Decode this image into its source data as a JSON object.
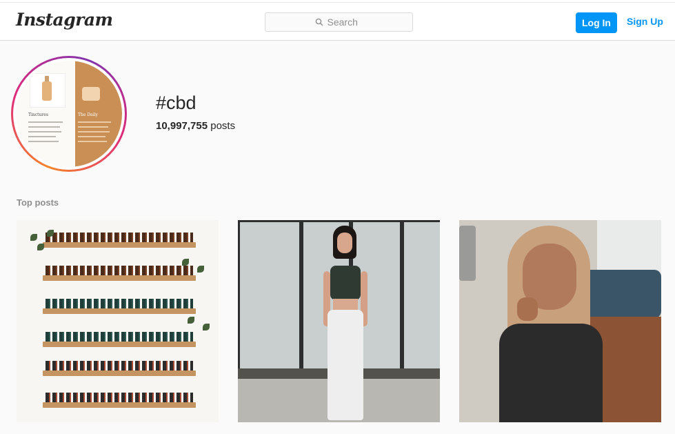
{
  "app": {
    "logo_text": "Instagram",
    "brand_color": "#0095f6"
  },
  "header": {
    "search_placeholder": "Search",
    "login_label": "Log In",
    "signup_label": "Sign Up"
  },
  "hashtag": {
    "title": "#cbd",
    "post_count": "10,997,755",
    "post_count_suffix": " posts",
    "avatar_labels": [
      "Tinctures",
      "The Daily"
    ]
  },
  "top_posts": {
    "section_title": "Top posts",
    "posts": [
      {
        "subject": "essential oil bottles on wooden shelves"
      },
      {
        "subject": "woman in white jeans standing by windows"
      },
      {
        "subject": "woman with long hair in black top"
      }
    ]
  }
}
